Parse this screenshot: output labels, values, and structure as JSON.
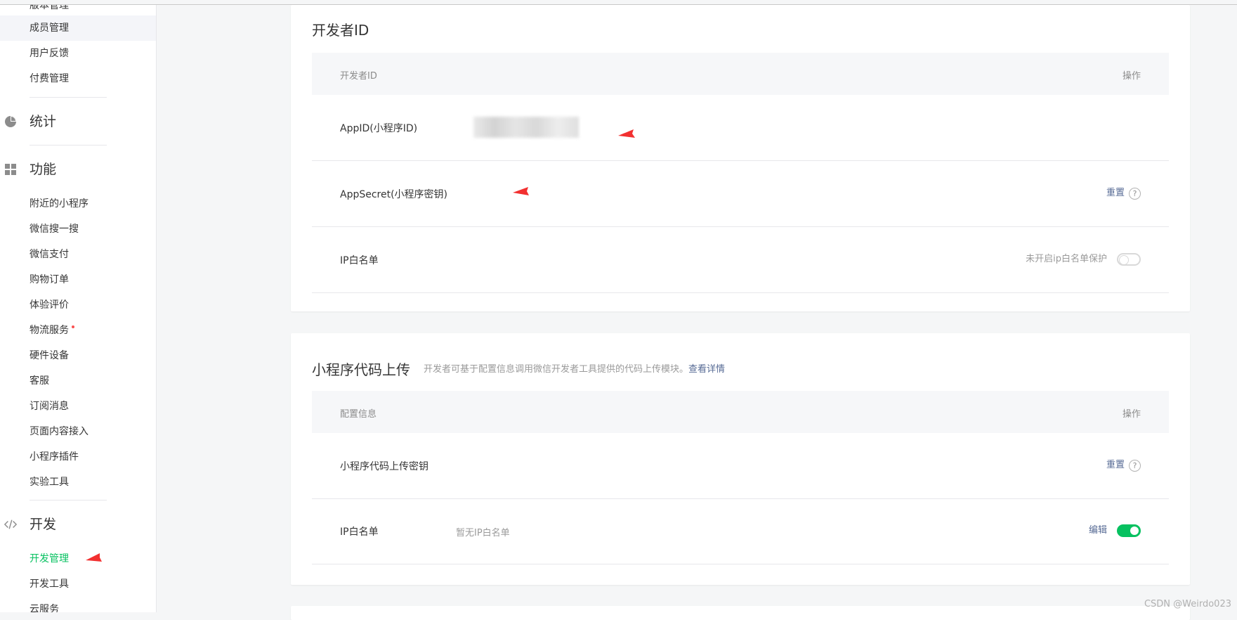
{
  "sidebar": {
    "partial_top_label": "版本管理",
    "items_top": [
      {
        "label": "成员管理"
      },
      {
        "label": "用户反馈"
      },
      {
        "label": "付费管理"
      }
    ],
    "groups": {
      "stats": "统计",
      "features": "功能",
      "dev": "开发"
    },
    "feature_items": [
      {
        "label": "附近的小程序"
      },
      {
        "label": "微信搜一搜"
      },
      {
        "label": "微信支付"
      },
      {
        "label": "购物订单"
      },
      {
        "label": "体验评价"
      },
      {
        "label": "物流服务"
      },
      {
        "label": "硬件设备"
      },
      {
        "label": "客服"
      },
      {
        "label": "订阅消息"
      },
      {
        "label": "页面内容接入"
      },
      {
        "label": "小程序插件"
      },
      {
        "label": "实验工具"
      }
    ],
    "dev_items": [
      {
        "label": "开发管理"
      },
      {
        "label": "开发工具"
      },
      {
        "label": "云服务"
      }
    ],
    "current_color": "#07c160"
  },
  "dev_id_card": {
    "title": "开发者ID",
    "header_left": "开发者ID",
    "header_right": "操作",
    "rows": [
      {
        "label": "AppID(小程序ID)"
      },
      {
        "label": "AppSecret(小程序密钥)",
        "action": "重置",
        "help": "?"
      },
      {
        "label": "IP白名单",
        "status": "未开启ip白名单保护",
        "toggle": "off"
      }
    ]
  },
  "upload_card": {
    "title": "小程序代码上传",
    "desc": "开发者可基于配置信息调用微信开发者工具提供的代码上传模块。",
    "desc_link": "查看详情",
    "header_left": "配置信息",
    "header_right": "操作",
    "rows": [
      {
        "label": "小程序代码上传密钥",
        "action": "重置",
        "help": "?"
      },
      {
        "label": "IP白名单",
        "value": "暂无IP白名单",
        "action": "编辑",
        "toggle": "on"
      }
    ]
  },
  "watermark": "CSDN @Weirdo023",
  "colors": {
    "accent_green": "#07c160",
    "link_blue": "#576b95",
    "annotation_red": "#f23030"
  }
}
